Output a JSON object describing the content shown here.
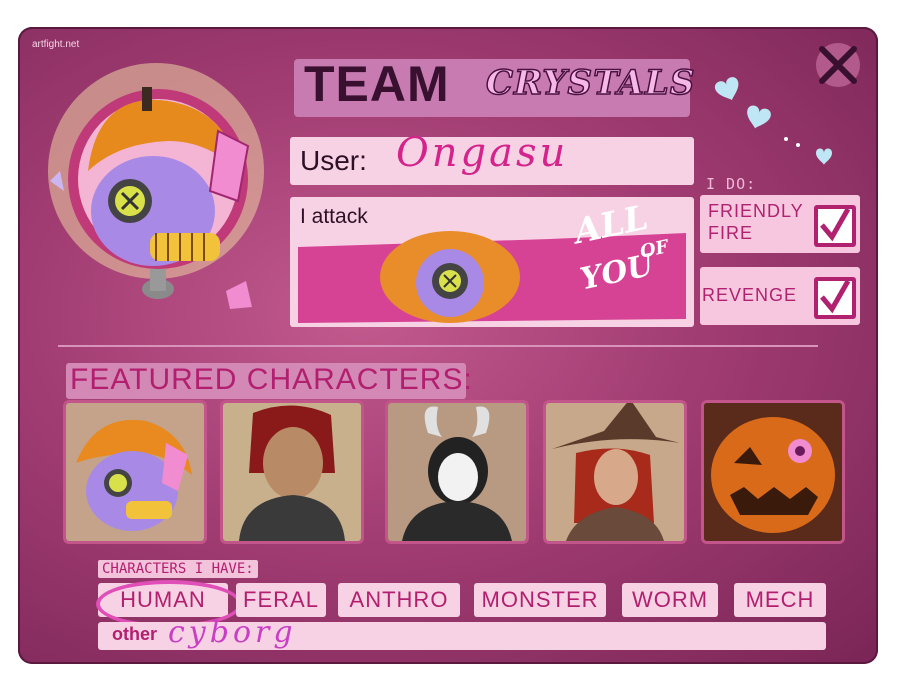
{
  "site": "artfight.net",
  "team": {
    "prefix": "TEAM",
    "name": "CRYSTALS"
  },
  "user": {
    "label": "User:",
    "name": "Ongasu"
  },
  "attack": {
    "label": "I attack",
    "line1": "ALL",
    "line2": "YOU",
    "overlay_of": "OF"
  },
  "ido": {
    "label": "I DO:",
    "options": [
      {
        "label_line1": "FRIENDLY",
        "label_line2": "FIRE",
        "checked": true
      },
      {
        "label_line1": "REVENGE",
        "label_line2": "",
        "checked": true
      }
    ]
  },
  "featured": {
    "title": "FEATURED CHARACTERS:",
    "thumbs": [
      "pumpkin-doll",
      "red-haired-man",
      "horned-creature",
      "witch-woman",
      "jack-o-lantern"
    ]
  },
  "characters": {
    "label": "CHARACTERS I HAVE:",
    "tags": [
      "HUMAN",
      "FERAL",
      "ANTHRO",
      "MONSTER",
      "WORM",
      "MECH"
    ],
    "selected": "HUMAN",
    "other_label": "other",
    "other_value": "cyborg"
  },
  "colors": {
    "accent": "#b21f6e",
    "panel": "#f7d2e4",
    "bg": "#a23d73"
  }
}
